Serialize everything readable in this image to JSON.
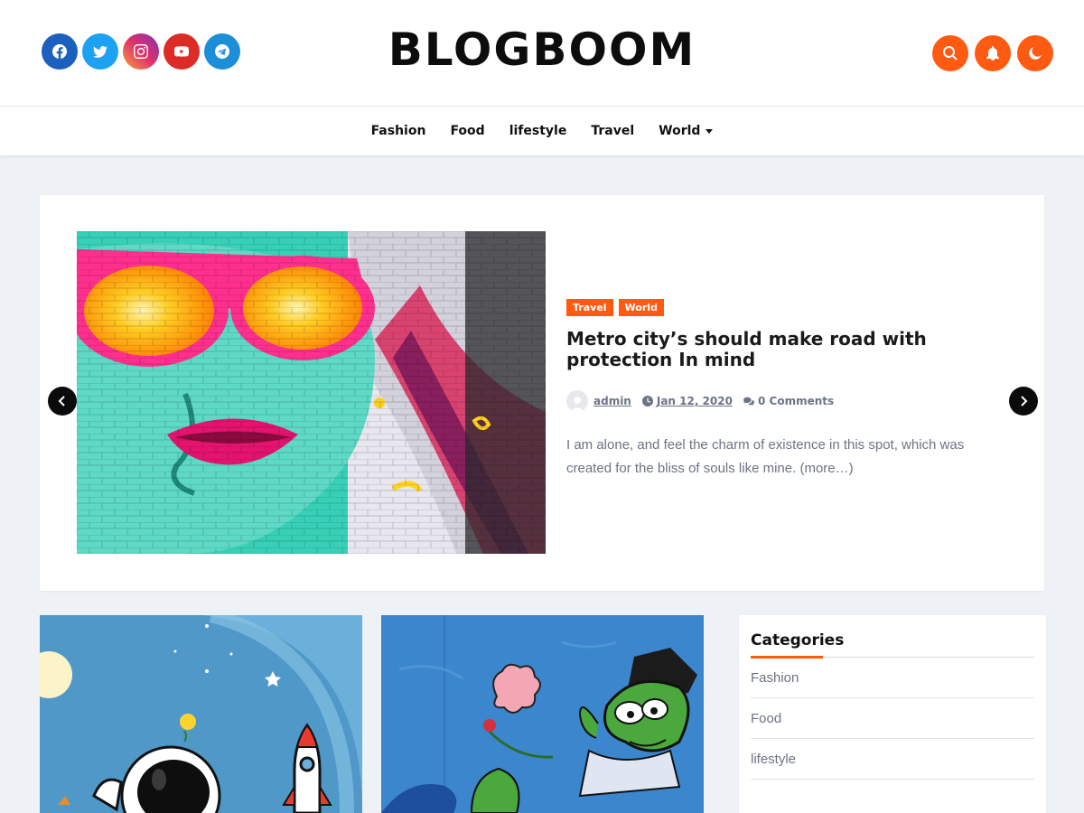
{
  "header": {
    "site_title": "BLOGBOOM",
    "social": [
      {
        "name": "facebook-icon",
        "color": "#1b5fbf"
      },
      {
        "name": "twitter-icon",
        "color": "#1da1f2"
      },
      {
        "name": "instagram-icon",
        "color": "#e1306c"
      },
      {
        "name": "youtube-icon",
        "color": "#dd2c26"
      },
      {
        "name": "telegram-icon",
        "color": "#1d8fd8"
      }
    ],
    "actions": [
      "search-icon",
      "bell-icon",
      "moon-icon"
    ],
    "accent_color": "#ff5a12"
  },
  "nav": {
    "items": [
      {
        "label": "Fashion"
      },
      {
        "label": "Food"
      },
      {
        "label": "lifestyle"
      },
      {
        "label": "Travel"
      },
      {
        "label": "World",
        "has_dropdown": true
      }
    ]
  },
  "featured": {
    "tags": [
      "Travel",
      "World"
    ],
    "title": "Metro city’s should make road with protection In mind",
    "author": "admin",
    "date": "Jan 12, 2020",
    "comments": "0 Comments",
    "excerpt": "I am alone, and feel the charm of existence in this spot, which was created for the bliss of souls like mine. (more…)"
  },
  "sidebar": {
    "title": "Categories",
    "categories": [
      "Fashion",
      "Food",
      "lifestyle"
    ]
  }
}
